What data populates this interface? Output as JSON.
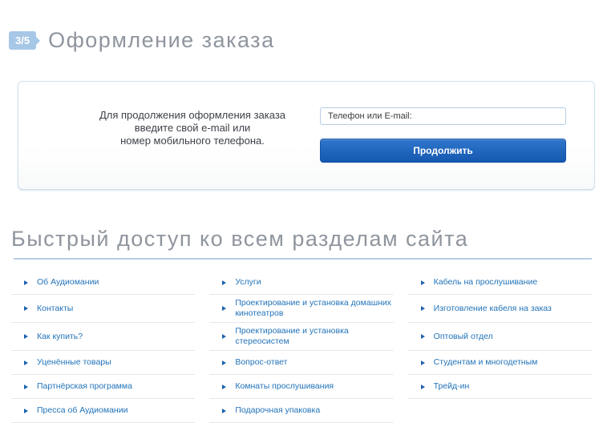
{
  "header": {
    "step_badge": "3/5",
    "title": "Оформление заказа"
  },
  "checkout_panel": {
    "instruction_lines": [
      "Для продолжения оформления заказа",
      "введите свой e-mail или",
      "номер мобильного телефона."
    ],
    "phone_input": {
      "value": "",
      "placeholder": "Телефон или E-mail:"
    },
    "continue_button_label": "Продолжить"
  },
  "quick_access": {
    "title": "Быстрый доступ ко всем разделам сайта",
    "columns": [
      {
        "links": [
          "Об Аудиомании",
          "Контакты",
          "Как купить?",
          "Уценённые товары",
          "Партнёрская программа",
          "Пресса об Аудиомании"
        ]
      },
      {
        "links": [
          "Услуги",
          "Проектирование и установка домашних кинотеатров",
          "Проектирование и установка стереосистем",
          "Вопрос-ответ",
          "Комнаты прослушивания",
          "Подарочная упаковка"
        ]
      },
      {
        "links": [
          "Кабель на прослушивание",
          "Изготовление кабеля на заказ",
          "Оптовый отдел",
          "Студентам и многодетным",
          "Трейд-ин"
        ]
      }
    ]
  },
  "icons": {
    "link_marker": "triangle-right-icon"
  },
  "colors": {
    "badge_blue": "#a7c7e7",
    "heading_gray": "#8f959e",
    "link_blue": "#2273b9",
    "marker_blue": "#1e62b0",
    "button_gradient_top": "#2e76cb",
    "button_gradient_bottom": "#1558b0",
    "panel_border": "#cfe0ef",
    "section_divider_blue": "#b7cfe6",
    "row_divider_gray": "#e4e9ee"
  }
}
